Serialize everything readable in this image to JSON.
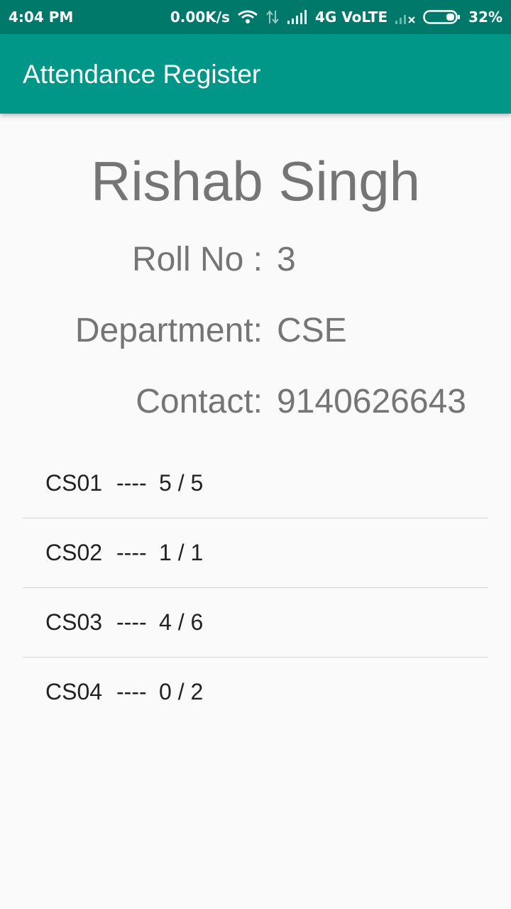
{
  "status_bar": {
    "time": "4:04 PM",
    "speed": "0.00K/s",
    "network": "4G VoLTE",
    "battery": "32%",
    "icons": [
      "wifi-icon",
      "data-arrows-icon",
      "signal-icon",
      "signal-off-icon",
      "battery-icon"
    ]
  },
  "app_bar": {
    "title": "Attendance Register"
  },
  "student": {
    "name": "Rishab Singh",
    "roll_label": "Roll No :",
    "roll": "3",
    "dept_label": "Department:",
    "dept": "CSE",
    "contact_label": "Contact:",
    "contact": "9140626643"
  },
  "subjects": [
    {
      "code": "CS01",
      "sep": "----",
      "count": "5 / 5"
    },
    {
      "code": "CS02",
      "sep": "----",
      "count": "1 / 1"
    },
    {
      "code": "CS03",
      "sep": "----",
      "count": "4 / 6"
    },
    {
      "code": "CS04",
      "sep": "----",
      "count": "0 / 2"
    }
  ],
  "colors": {
    "status_bar": "#00796b",
    "app_bar": "#009688",
    "background": "#fafafa",
    "text_gray": "#757575"
  }
}
